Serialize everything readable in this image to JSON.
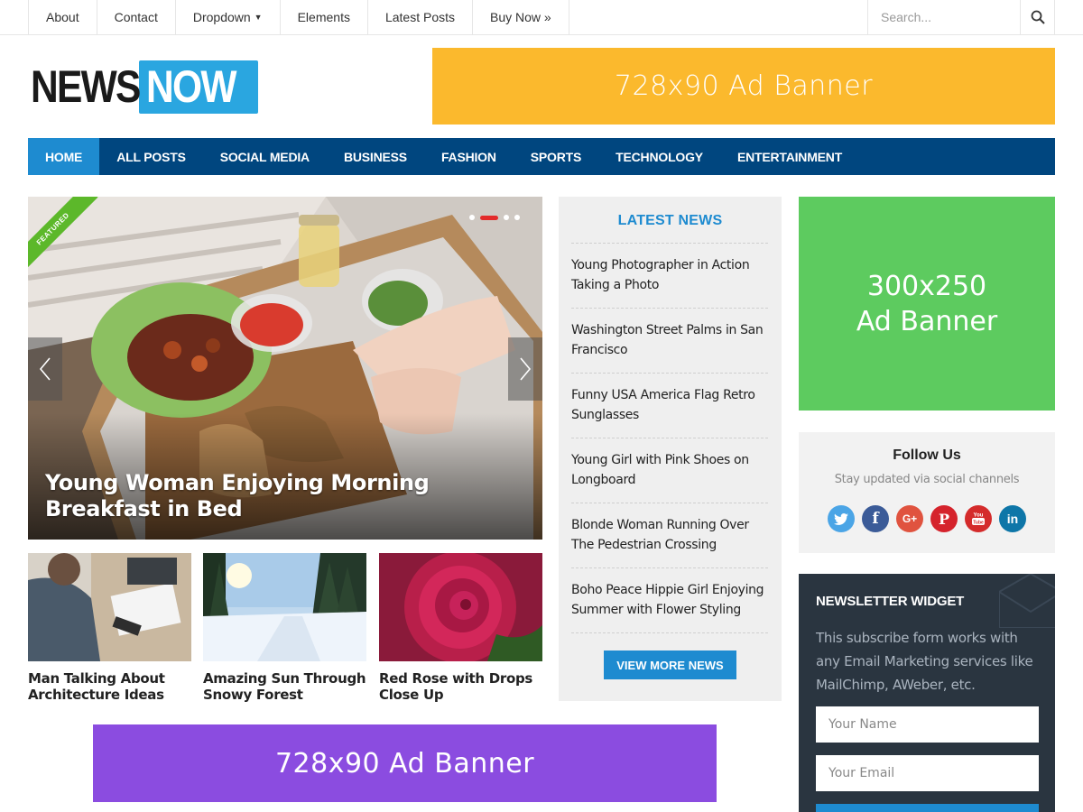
{
  "topnav": {
    "items": [
      {
        "label": "About"
      },
      {
        "label": "Contact"
      },
      {
        "label": "Dropdown"
      },
      {
        "label": "Elements"
      },
      {
        "label": "Latest Posts"
      },
      {
        "label": "Buy Now »"
      }
    ],
    "search_placeholder": "Search..."
  },
  "logo": {
    "word1": "NEWS",
    "word2": "NOW"
  },
  "ads": {
    "top": "728x90 Ad Banner",
    "side_line1": "300x250",
    "side_line2": "Ad Banner",
    "bottom": "728x90 Ad Banner"
  },
  "mainnav": {
    "items": [
      {
        "label": "HOME",
        "active": true
      },
      {
        "label": "ALL POSTS"
      },
      {
        "label": "SOCIAL MEDIA"
      },
      {
        "label": "BUSINESS"
      },
      {
        "label": "FASHION"
      },
      {
        "label": "SPORTS"
      },
      {
        "label": "TECHNOLOGY"
      },
      {
        "label": "ENTERTAINMENT"
      }
    ]
  },
  "slider": {
    "badge": "FEATURED",
    "title": "Young Woman Enjoying Morning Breakfast in Bed",
    "slide_count": 4,
    "active_slide": 2
  },
  "thumbs": [
    {
      "caption": "Man Talking About Architecture Ideas"
    },
    {
      "caption": "Amazing Sun Through Snowy Forest"
    },
    {
      "caption": "Red Rose with Drops Close Up"
    }
  ],
  "latest": {
    "heading": "LATEST NEWS",
    "items": [
      "Young Photographer in Action Taking a Photo",
      "Washington Street Palms in San Francisco",
      "Funny USA America Flag Retro Sunglasses",
      "Young Girl with Pink Shoes on Longboard",
      "Blonde Woman Running Over The Pedestrian Crossing",
      "Boho Peace Hippie Girl Enjoying Summer with Flower Styling"
    ],
    "more_button": "VIEW MORE NEWS"
  },
  "follow": {
    "heading": "Follow Us",
    "subtitle": "Stay updated via social channels",
    "icons": [
      "twitter-icon",
      "facebook-icon",
      "google-plus-icon",
      "pinterest-icon",
      "youtube-icon",
      "linkedin-icon"
    ]
  },
  "newsletter": {
    "heading": "NEWSLETTER WIDGET",
    "text": "This subscribe form works with any Email Marketing services like MailChimp, AWeber, etc.",
    "name_placeholder": "Your Name",
    "email_placeholder": "Your Email"
  },
  "colors": {
    "nav_bg": "#00467f",
    "accent": "#1e8bd0",
    "ad_top": "#fbb92d",
    "ad_side": "#5dcb5f",
    "ad_bottom": "#8b4ce0",
    "newsletter_bg": "#2a3540"
  }
}
